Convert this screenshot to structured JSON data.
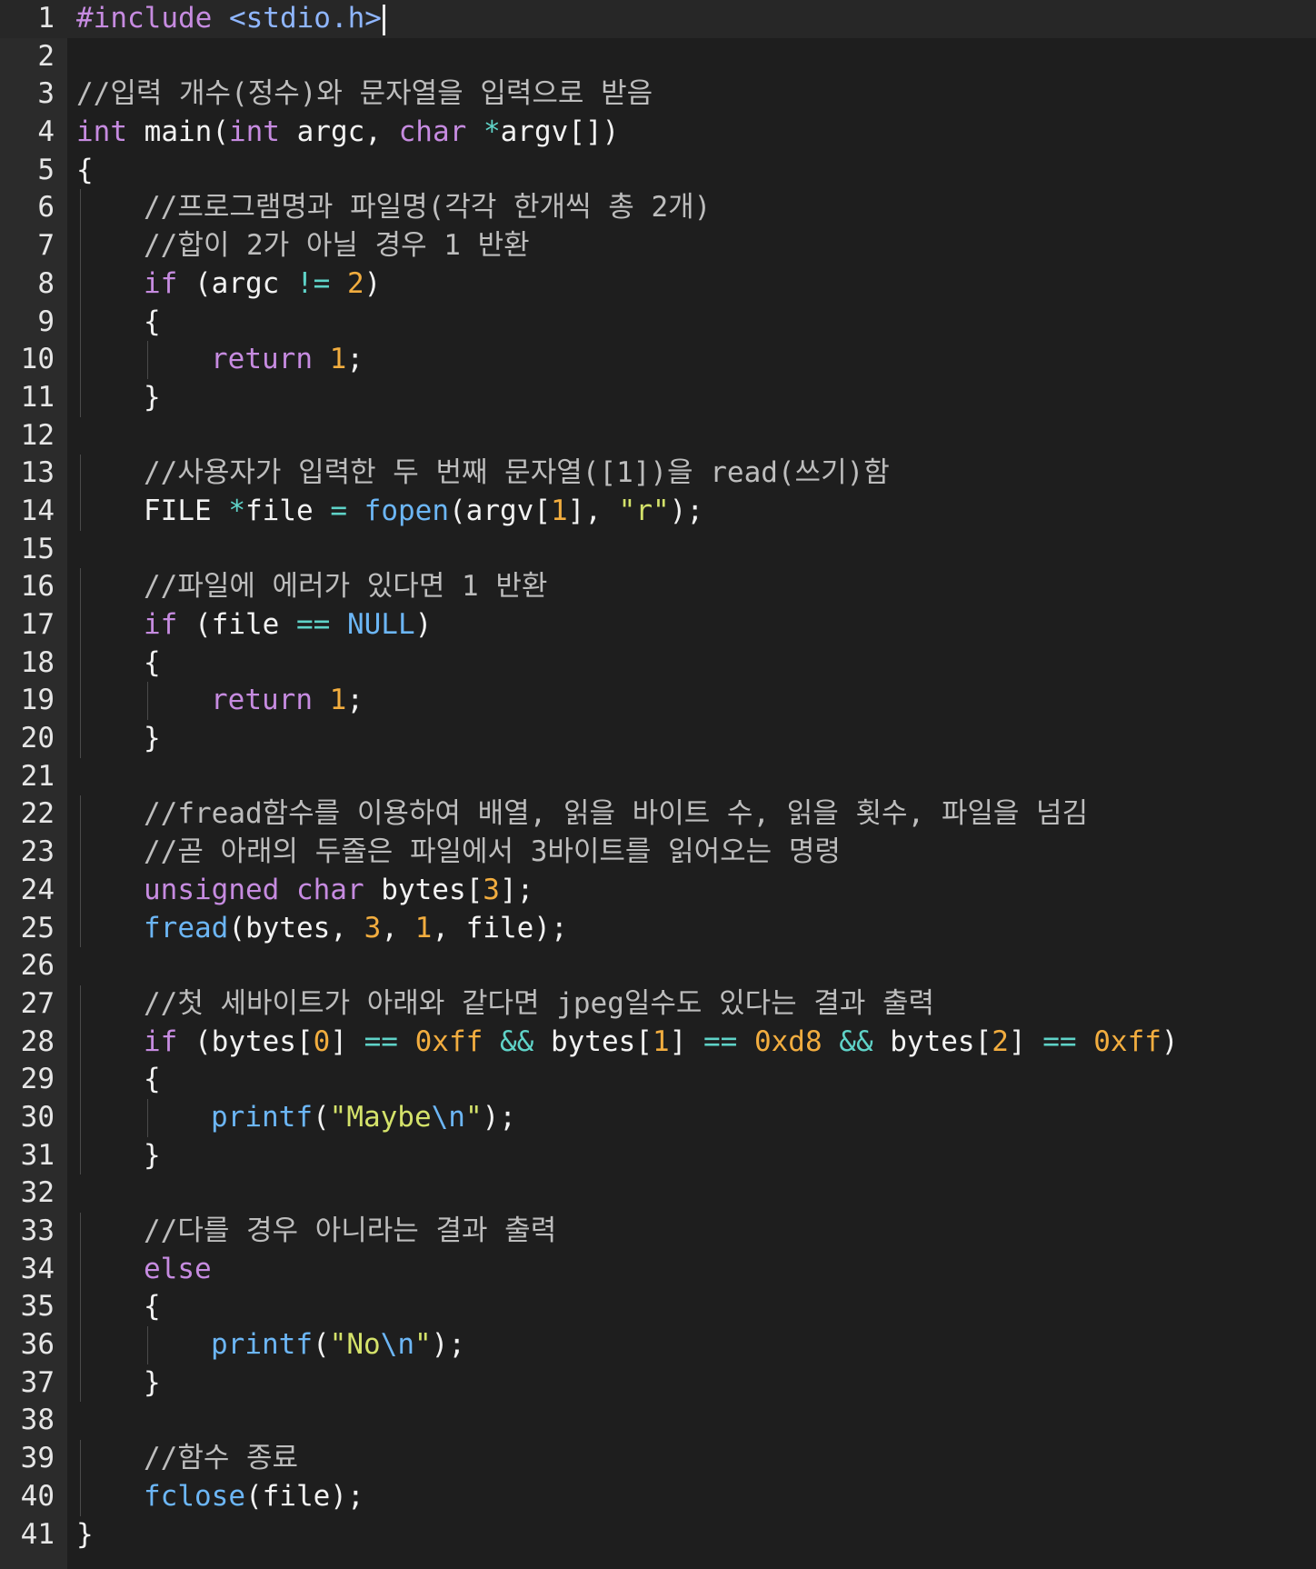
{
  "colors": {
    "background": "#1e1e1e",
    "gutter": "#2b2b2b",
    "text": "#f2f2f2",
    "comment": "#bdbdbd",
    "keyword": "#c68be0",
    "type": "#c68be0",
    "function": "#6cb6f5",
    "number": "#f2ad3f",
    "string": "#d4e26a",
    "operator": "#5fd3c8",
    "escape": "#6cb6f5",
    "preproc": "#c68be0",
    "include": "#8fb6ff"
  },
  "editor": {
    "active_line": 1,
    "lines": [
      {
        "n": "1",
        "indent": 0,
        "tokens": [
          {
            "t": "#include",
            "c": "preproc"
          },
          {
            "t": " "
          },
          {
            "t": "<stdio.h>",
            "c": "include"
          }
        ],
        "caret": true
      },
      {
        "n": "2",
        "indent": 0,
        "tokens": []
      },
      {
        "n": "3",
        "indent": 0,
        "tokens": [
          {
            "t": "//입력 개수(정수)와 문자열을 입력으로 받음",
            "c": "comment"
          }
        ]
      },
      {
        "n": "4",
        "indent": 0,
        "tokens": [
          {
            "t": "int",
            "c": "type"
          },
          {
            "t": " main("
          },
          {
            "t": "int",
            "c": "type"
          },
          {
            "t": " argc, "
          },
          {
            "t": "char",
            "c": "type"
          },
          {
            "t": " "
          },
          {
            "t": "*",
            "c": "operator"
          },
          {
            "t": "argv[])"
          }
        ]
      },
      {
        "n": "5",
        "indent": 0,
        "tokens": [
          {
            "t": "{"
          }
        ]
      },
      {
        "n": "6",
        "indent": 1,
        "tokens": [
          {
            "t": "//프로그램명과 파일명(각각 한개씩 총 2개)",
            "c": "comment"
          }
        ]
      },
      {
        "n": "7",
        "indent": 1,
        "tokens": [
          {
            "t": "//합이 2가 아닐 경우 1 반환",
            "c": "comment"
          }
        ]
      },
      {
        "n": "8",
        "indent": 1,
        "tokens": [
          {
            "t": "if",
            "c": "keyword"
          },
          {
            "t": " (argc "
          },
          {
            "t": "!=",
            "c": "operator"
          },
          {
            "t": " "
          },
          {
            "t": "2",
            "c": "number"
          },
          {
            "t": ")"
          }
        ]
      },
      {
        "n": "9",
        "indent": 1,
        "tokens": [
          {
            "t": "{"
          }
        ]
      },
      {
        "n": "10",
        "indent": 2,
        "tokens": [
          {
            "t": "return",
            "c": "keyword"
          },
          {
            "t": " "
          },
          {
            "t": "1",
            "c": "number"
          },
          {
            "t": ";"
          }
        ]
      },
      {
        "n": "11",
        "indent": 1,
        "tokens": [
          {
            "t": "}"
          }
        ]
      },
      {
        "n": "12",
        "indent": 0,
        "tokens": []
      },
      {
        "n": "13",
        "indent": 1,
        "tokens": [
          {
            "t": "//사용자가 입력한 두 번째 문자열([1])을 read(쓰기)함",
            "c": "comment"
          }
        ]
      },
      {
        "n": "14",
        "indent": 1,
        "tokens": [
          {
            "t": "FILE "
          },
          {
            "t": "*",
            "c": "operator"
          },
          {
            "t": "file "
          },
          {
            "t": "=",
            "c": "operator"
          },
          {
            "t": " "
          },
          {
            "t": "fopen",
            "c": "function"
          },
          {
            "t": "(argv["
          },
          {
            "t": "1",
            "c": "number"
          },
          {
            "t": "], "
          },
          {
            "t": "\"r\"",
            "c": "string"
          },
          {
            "t": ");"
          }
        ]
      },
      {
        "n": "15",
        "indent": 0,
        "tokens": []
      },
      {
        "n": "16",
        "indent": 1,
        "tokens": [
          {
            "t": "//파일에 에러가 있다면 1 반환",
            "c": "comment"
          }
        ]
      },
      {
        "n": "17",
        "indent": 1,
        "tokens": [
          {
            "t": "if",
            "c": "keyword"
          },
          {
            "t": " (file "
          },
          {
            "t": "==",
            "c": "operator"
          },
          {
            "t": " "
          },
          {
            "t": "NULL",
            "c": "function"
          },
          {
            "t": ")"
          }
        ]
      },
      {
        "n": "18",
        "indent": 1,
        "tokens": [
          {
            "t": "{"
          }
        ]
      },
      {
        "n": "19",
        "indent": 2,
        "tokens": [
          {
            "t": "return",
            "c": "keyword"
          },
          {
            "t": " "
          },
          {
            "t": "1",
            "c": "number"
          },
          {
            "t": ";"
          }
        ]
      },
      {
        "n": "20",
        "indent": 1,
        "tokens": [
          {
            "t": "}"
          }
        ]
      },
      {
        "n": "21",
        "indent": 0,
        "tokens": []
      },
      {
        "n": "22",
        "indent": 1,
        "tokens": [
          {
            "t": "//fread함수를 이용하여 배열, 읽을 바이트 수, 읽을 횟수, 파일을 넘김",
            "c": "comment"
          }
        ]
      },
      {
        "n": "23",
        "indent": 1,
        "tokens": [
          {
            "t": "//곧 아래의 두줄은 파일에서 3바이트를 읽어오는 명령",
            "c": "comment"
          }
        ]
      },
      {
        "n": "24",
        "indent": 1,
        "tokens": [
          {
            "t": "unsigned",
            "c": "type"
          },
          {
            "t": " "
          },
          {
            "t": "char",
            "c": "type"
          },
          {
            "t": " bytes["
          },
          {
            "t": "3",
            "c": "number"
          },
          {
            "t": "];"
          }
        ]
      },
      {
        "n": "25",
        "indent": 1,
        "tokens": [
          {
            "t": "fread",
            "c": "function"
          },
          {
            "t": "(bytes, "
          },
          {
            "t": "3",
            "c": "number"
          },
          {
            "t": ", "
          },
          {
            "t": "1",
            "c": "number"
          },
          {
            "t": ", file);"
          }
        ]
      },
      {
        "n": "26",
        "indent": 0,
        "tokens": []
      },
      {
        "n": "27",
        "indent": 1,
        "tokens": [
          {
            "t": "//첫 세바이트가 아래와 같다면 jpeg일수도 있다는 결과 출력",
            "c": "comment"
          }
        ]
      },
      {
        "n": "28",
        "indent": 1,
        "tokens": [
          {
            "t": "if",
            "c": "keyword"
          },
          {
            "t": " (bytes["
          },
          {
            "t": "0",
            "c": "number"
          },
          {
            "t": "] "
          },
          {
            "t": "==",
            "c": "operator"
          },
          {
            "t": " "
          },
          {
            "t": "0xff",
            "c": "number"
          },
          {
            "t": " "
          },
          {
            "t": "&&",
            "c": "operator"
          },
          {
            "t": " bytes["
          },
          {
            "t": "1",
            "c": "number"
          },
          {
            "t": "] "
          },
          {
            "t": "==",
            "c": "operator"
          },
          {
            "t": " "
          },
          {
            "t": "0xd8",
            "c": "number"
          },
          {
            "t": " "
          },
          {
            "t": "&&",
            "c": "operator"
          },
          {
            "t": " bytes["
          },
          {
            "t": "2",
            "c": "number"
          },
          {
            "t": "] "
          },
          {
            "t": "==",
            "c": "operator"
          },
          {
            "t": " "
          },
          {
            "t": "0xff",
            "c": "number"
          },
          {
            "t": ")"
          }
        ]
      },
      {
        "n": "29",
        "indent": 1,
        "tokens": [
          {
            "t": "{"
          }
        ]
      },
      {
        "n": "30",
        "indent": 2,
        "tokens": [
          {
            "t": "printf",
            "c": "function"
          },
          {
            "t": "("
          },
          {
            "t": "\"Maybe",
            "c": "string"
          },
          {
            "t": "\\n",
            "c": "escape"
          },
          {
            "t": "\"",
            "c": "string"
          },
          {
            "t": ");"
          }
        ]
      },
      {
        "n": "31",
        "indent": 1,
        "tokens": [
          {
            "t": "}"
          }
        ]
      },
      {
        "n": "32",
        "indent": 0,
        "tokens": []
      },
      {
        "n": "33",
        "indent": 1,
        "tokens": [
          {
            "t": "//다를 경우 아니라는 결과 출력",
            "c": "comment"
          }
        ]
      },
      {
        "n": "34",
        "indent": 1,
        "tokens": [
          {
            "t": "else",
            "c": "keyword"
          }
        ]
      },
      {
        "n": "35",
        "indent": 1,
        "tokens": [
          {
            "t": "{"
          }
        ]
      },
      {
        "n": "36",
        "indent": 2,
        "tokens": [
          {
            "t": "printf",
            "c": "function"
          },
          {
            "t": "("
          },
          {
            "t": "\"No",
            "c": "string"
          },
          {
            "t": "\\n",
            "c": "escape"
          },
          {
            "t": "\"",
            "c": "string"
          },
          {
            "t": ");"
          }
        ]
      },
      {
        "n": "37",
        "indent": 1,
        "tokens": [
          {
            "t": "}"
          }
        ]
      },
      {
        "n": "38",
        "indent": 0,
        "tokens": []
      },
      {
        "n": "39",
        "indent": 1,
        "tokens": [
          {
            "t": "//함수 종료",
            "c": "comment"
          }
        ]
      },
      {
        "n": "40",
        "indent": 1,
        "tokens": [
          {
            "t": "fclose",
            "c": "function"
          },
          {
            "t": "(file);"
          }
        ]
      },
      {
        "n": "41",
        "indent": 0,
        "tokens": [
          {
            "t": "}"
          }
        ]
      }
    ]
  }
}
